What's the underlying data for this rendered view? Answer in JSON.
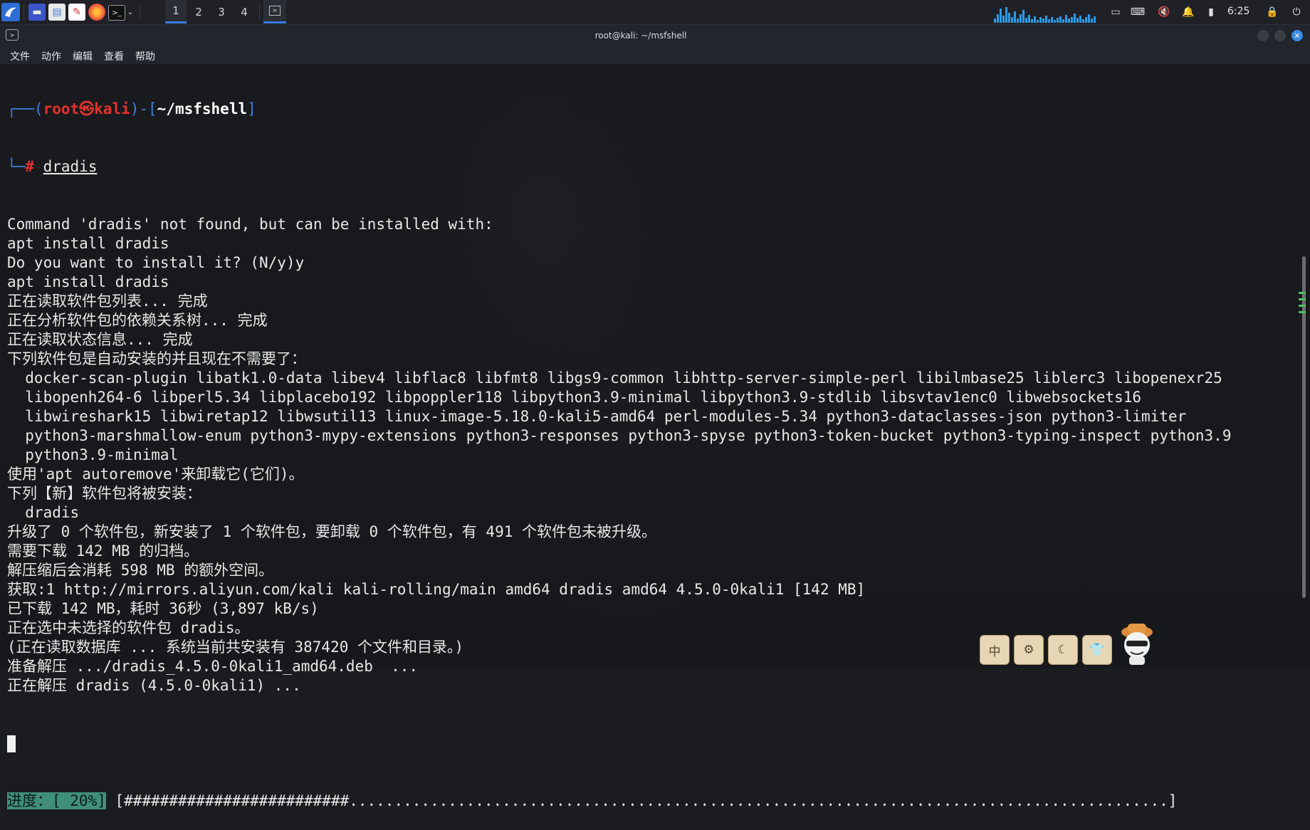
{
  "taskbar": {
    "workspaces": [
      "1",
      "2",
      "3",
      "4"
    ],
    "active_workspace": "1",
    "clock": "6:25",
    "launcher_icons": [
      "kali-menu-icon",
      "desktop-icon",
      "file-manager-icon",
      "text-editor-icon",
      "firefox-icon",
      "terminal-icon"
    ]
  },
  "window": {
    "title": "root@kali: ~/msfshell",
    "menu": [
      "文件",
      "动作",
      "编辑",
      "查看",
      "帮助"
    ]
  },
  "prompt": {
    "user": "root",
    "at_symbol": "㉿",
    "host": "kali",
    "path": "~/msfshell",
    "hash": "#",
    "command": "dradis"
  },
  "output_lines": [
    "Command 'dradis' not found, but can be installed with:",
    "apt install dradis",
    "Do you want to install it? (N/y)y",
    "apt install dradis",
    "正在读取软件包列表... 完成",
    "正在分析软件包的依赖关系树... 完成",
    "正在读取状态信息... 完成",
    "下列软件包是自动安装的并且现在不需要了：",
    "  docker-scan-plugin libatk1.0-data libev4 libflac8 libfmt8 libgs9-common libhttp-server-simple-perl libilmbase25 liblerc3 libopenexr25",
    "  libopenh264-6 libperl5.34 libplacebo192 libpoppler118 libpython3.9-minimal libpython3.9-stdlib libsvtav1enc0 libwebsockets16",
    "  libwireshark15 libwiretap12 libwsutil13 linux-image-5.18.0-kali5-amd64 perl-modules-5.34 python3-dataclasses-json python3-limiter",
    "  python3-marshmallow-enum python3-mypy-extensions python3-responses python3-spyse python3-token-bucket python3-typing-inspect python3.9",
    "  python3.9-minimal",
    "使用'apt autoremove'来卸载它(它们)。",
    "下列【新】软件包将被安装：",
    "  dradis",
    "升级了 0 个软件包，新安装了 1 个软件包，要卸载 0 个软件包，有 491 个软件包未被升级。",
    "需要下载 142 MB 的归档。",
    "解压缩后会消耗 598 MB 的额外空间。",
    "获取:1 http://mirrors.aliyun.com/kali kali-rolling/main amd64 dradis amd64 4.5.0-0kali1 [142 MB]",
    "已下载 142 MB，耗时 36秒 (3,897 kB/s)",
    "正在选中未选择的软件包 dradis。",
    "(正在读取数据库 ... 系统当前共安装有 387420 个文件和目录。)",
    "准备解压 .../dradis_4.5.0-0kali1_amd64.deb  ...",
    "正在解压 dradis (4.5.0-0kali1) ..."
  ],
  "progress": {
    "label": "进度：[ 20%]",
    "bar": "[#########################...........................................................................................]",
    "percent": 20
  },
  "overlay_buttons": [
    "中",
    "⚙",
    "☾",
    "👕"
  ],
  "colors": {
    "prompt_blue": "#3f7ee0",
    "prompt_red": "#e5302d",
    "progress_bg": "#3f8f7a",
    "active_workspace": "#3a7be0"
  }
}
